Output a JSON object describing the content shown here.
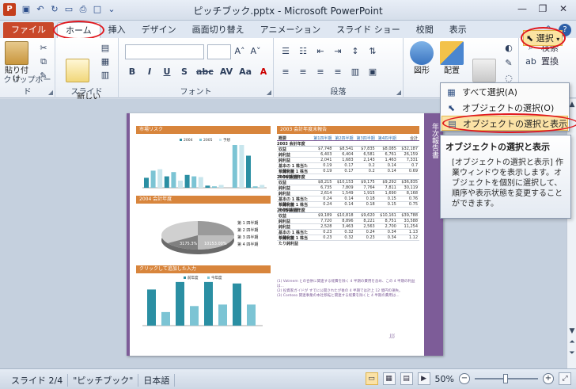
{
  "window": {
    "title": "ピッチブック.pptx - Microsoft PowerPoint",
    "app_icon_letter": "P",
    "qat": [
      "save-icon",
      "undo-icon",
      "redo-icon",
      "open-icon",
      "print-preview-icon",
      "new-icon",
      "customize-icon"
    ],
    "controls": [
      "minimize",
      "restore",
      "close"
    ]
  },
  "tabs": {
    "file": "ファイル",
    "items": [
      "ホーム",
      "挿入",
      "デザイン",
      "画面切り替え",
      "アニメーション",
      "スライド ショー",
      "校閲",
      "表示"
    ],
    "active": "ホーム"
  },
  "ribbon": {
    "clipboard": {
      "label": "クリップボード",
      "paste": "貼り付け"
    },
    "slides": {
      "label": "スライド",
      "new_slide": "新しい\nスライド"
    },
    "font": {
      "label": "フォント"
    },
    "paragraph": {
      "label": "段落"
    },
    "drawing": {
      "shapes": "図形",
      "arrange": "配置",
      "quick_style": "クイック\nスタイル"
    },
    "editing": {
      "find": "検索",
      "replace": "置換",
      "select": "選択"
    }
  },
  "select_menu": {
    "items": [
      {
        "label": "すべて選択(A)",
        "icon": "select-all-icon"
      },
      {
        "label": "オブジェクトの選択(O)",
        "icon": "cursor-icon"
      },
      {
        "label": "オブジェクトの選択と表示(P)...",
        "icon": "selection-pane-icon"
      }
    ],
    "highlighted": 2
  },
  "tooltip": {
    "title": "オブジェクトの選択と表示",
    "body": "[オブジェクトの選択と表示] 作業ウィンドウを表示します。オブジェクトを個別に選択して、順序や表示状態を変更することができます。"
  },
  "slide": {
    "side_title": "年次報告書",
    "sections": {
      "market": "市場リスク",
      "fiscal": "2003 会計年度末報告",
      "forecast": "2004 会計年度",
      "credit": "クリックして追加した入力"
    },
    "legend_bars": [
      "2004",
      "2005",
      "予想"
    ],
    "legend_pie": [
      "第 1 四半期",
      "第 2 四半期",
      "第 3 四半期",
      "第 4 四半期"
    ],
    "legend_bars2": [
      "前年度",
      "今年度"
    ],
    "table_head": [
      "概要",
      "第1四半期",
      "第2四半期",
      "第3四半期",
      "第4四半期",
      "合計"
    ],
    "table_groups": [
      {
        "label": "2003 会計年度",
        "rows": [
          [
            "収益",
            "$7,748",
            "$8,541",
            "$7,835",
            "$8,085",
            "$32,187"
          ],
          [
            "純利益",
            "6,403",
            "6,404",
            "6,581",
            "6,761",
            "26,159"
          ],
          [
            "純利益",
            "2,041",
            "1,683",
            "2,143",
            "1,463",
            "7,331"
          ],
          [
            "基本の 1 株当たり純利益",
            "0.19",
            "0.17",
            "0.2",
            "0.14",
            "0.7"
          ],
          [
            "希薄化後 1 株当たり純利益",
            "0.19",
            "0.17",
            "0.2",
            "0.14",
            "0.69"
          ]
        ]
      },
      {
        "label": "2004 会計年度",
        "rows": [
          [
            "収益",
            "$8,215",
            "$10,153",
            "$9,175",
            "$9,292",
            "$36,835"
          ],
          [
            "純利益",
            "6,735",
            "7,809",
            "7,764",
            "7,811",
            "30,119"
          ],
          [
            "純利益",
            "2,614",
            "1,549",
            "1,915",
            "1,690",
            "8,168"
          ],
          [
            "基本の 1 株当たり純利益",
            "0.24",
            "0.14",
            "0.18",
            "0.15",
            "0.76"
          ],
          [
            "希薄化後 1 株当たり純利益",
            "0.24",
            "0.14",
            "0.18",
            "0.15",
            "0.75"
          ]
        ]
      },
      {
        "label": "2005 会計年度",
        "rows": [
          [
            "収益",
            "$9,189",
            "$10,818",
            "$9,620",
            "$10,161",
            "$39,788"
          ],
          [
            "純利益",
            "7,720",
            "8,896",
            "8,221",
            "8,751",
            "33,588"
          ],
          [
            "純利益",
            "2,528",
            "3,463",
            "2,563",
            "2,700",
            "11,254"
          ],
          [
            "基本の 1 株当たり純利益",
            "0.23",
            "0.32",
            "0.24",
            "0.34",
            "1.13"
          ],
          [
            "希薄化後 1 株当たり純利益",
            "0.23",
            "0.32",
            "0.23",
            "0.34",
            "1.12"
          ]
        ]
      }
    ],
    "notes": [
      "(1) Vatreem との合併に関連する経費を除く 4 半期の費用を含め、この 4 半期の利益は...",
      "(2) 投資家ガイドが すでに公開されたが後の 4 半期では計上 12 億円の損失。",
      "(3) Contoso 関連事業の本社移転と関連する経費を除くと 4 半期の費用は..."
    ],
    "charts": {
      "bars1": [
        14,
        24,
        26,
        16,
        22,
        10,
        18,
        16,
        15,
        3,
        2,
        4,
        0,
        60,
        60,
        45,
        2,
        4
      ],
      "bars2": [
        48,
        18,
        58,
        26,
        58,
        28,
        56,
        28
      ]
    },
    "pie_labels": [
      "3175.3%",
      "10153.00%"
    ]
  },
  "status": {
    "slide": "スライド 2/4",
    "theme": "\"ピッチブック\"",
    "language": "日本語",
    "zoom": "50%"
  }
}
